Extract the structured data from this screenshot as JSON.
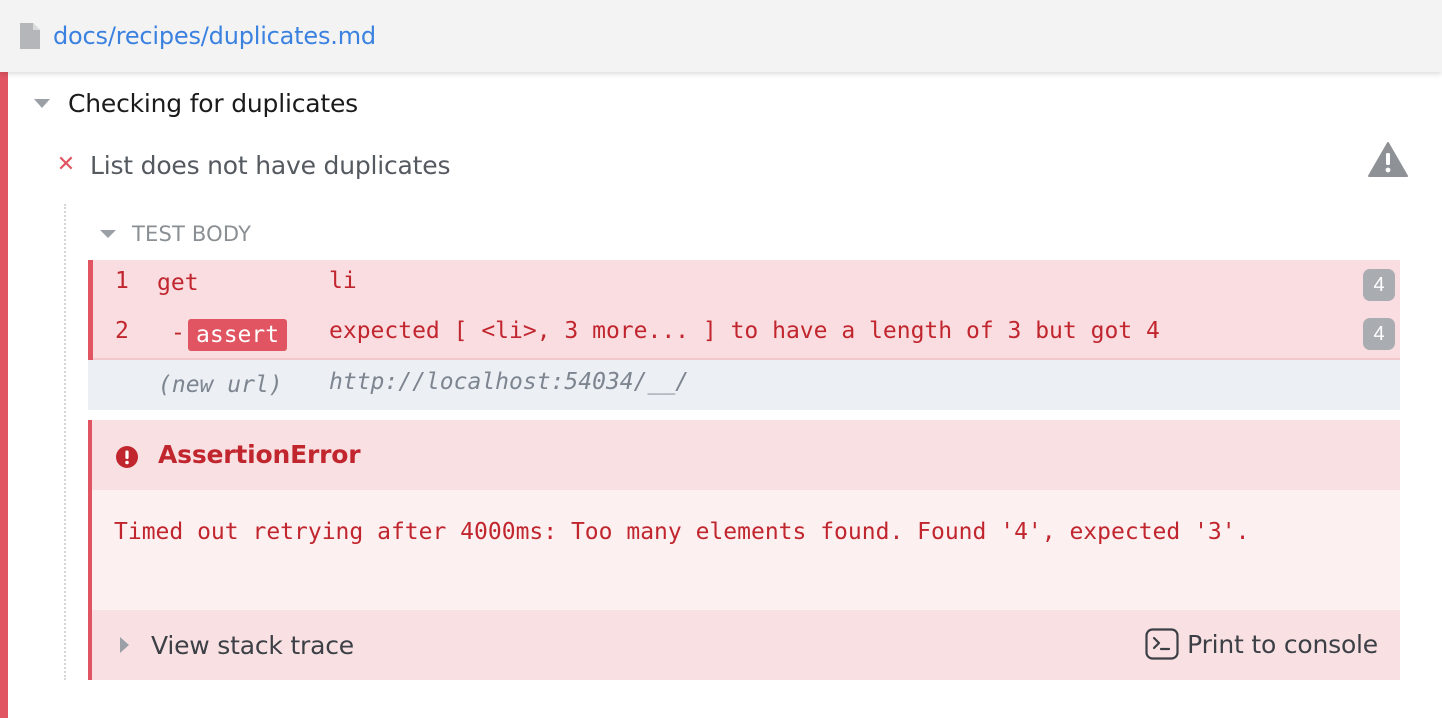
{
  "header": {
    "file_path": "docs/recipes/duplicates.md",
    "icon": "file-icon"
  },
  "suite": {
    "title": "Checking for duplicates",
    "state": "failed"
  },
  "test": {
    "title": "List does not have duplicates",
    "status_icon": "fail-x-icon",
    "warning_icon": "warning-icon"
  },
  "test_body": {
    "label": "TEST BODY",
    "commands": [
      {
        "number": "1",
        "name": "get",
        "message": "li",
        "count": "4"
      },
      {
        "number": "2",
        "prefix": "-",
        "name": "assert",
        "message": "expected [ <li>, 3 more... ] to have a length of 3 but got 4",
        "count": "4"
      }
    ],
    "event": {
      "label": "(new url)",
      "value": "http://localhost:54034/__/"
    }
  },
  "error": {
    "name": "AssertionError",
    "icon": "error-circle-icon",
    "message": "Timed out retrying after 4000ms: Too many elements found. Found '4', expected '3'.",
    "stack_trace_label": "View stack trace",
    "print_label": "Print to console",
    "print_icon": "terminal-icon"
  },
  "colors": {
    "accent_red": "#e05561",
    "error_text": "#c1262e",
    "link_blue": "#3b82e0",
    "badge_gray": "#a9acb0",
    "command_bg": "#f9dde0",
    "event_bg": "#eceff3"
  }
}
